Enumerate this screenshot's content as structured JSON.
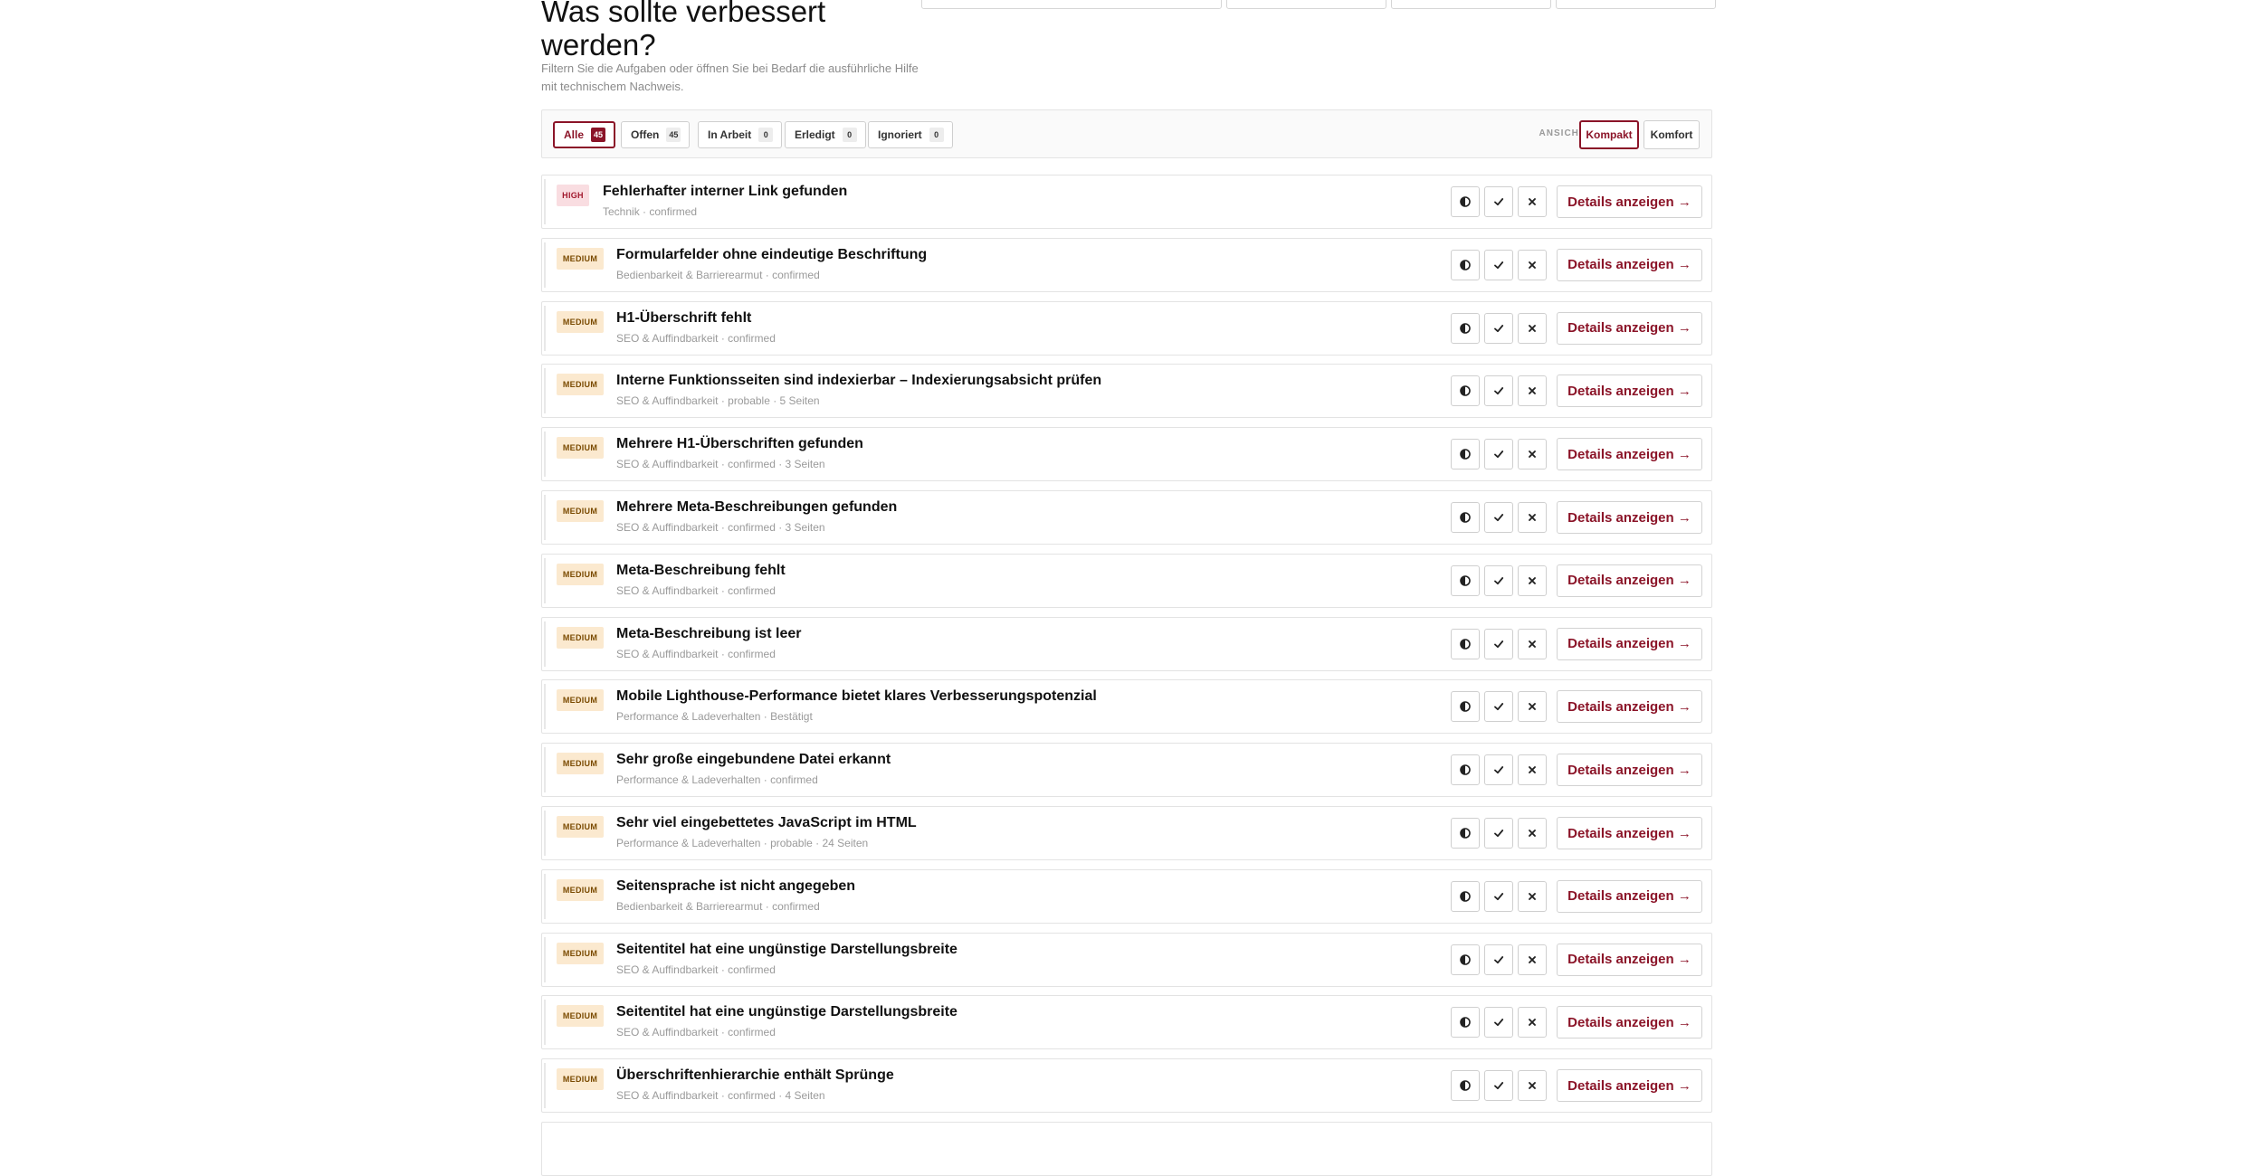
{
  "header": {
    "title": "Was sollte verbessert werden?",
    "subtitle": "Filtern Sie die Aufgaben oder öffnen Sie bei Bedarf die ausführliche Hilfe mit technischem Nachweis."
  },
  "filters": {
    "chips": [
      {
        "label": "Alle",
        "count": "45",
        "active": true
      },
      {
        "label": "Offen",
        "count": "45",
        "active": false
      },
      {
        "label": "In Arbeit",
        "count": "0",
        "active": false
      },
      {
        "label": "Erledigt",
        "count": "0",
        "active": false
      },
      {
        "label": "Ignoriert",
        "count": "0",
        "active": false
      }
    ],
    "view_label": "ANSICHT",
    "views": [
      {
        "label": "Kompakt",
        "active": true
      },
      {
        "label": "Komfort",
        "active": false
      }
    ]
  },
  "issue_actions": {
    "details_label": "Details anzeigen →",
    "icons": [
      "half-circle-icon",
      "check-icon",
      "close-icon"
    ]
  },
  "colors": {
    "accent": "#8b1428",
    "high_badge_bg": "#f9dde1",
    "medium_badge_bg": "#fbe9cf"
  },
  "issues": [
    {
      "severity": "HIGH",
      "title": "Fehlerhafter interner Link gefunden",
      "meta": "Technik · confirmed"
    },
    {
      "severity": "MEDIUM",
      "title": "Formularfelder ohne eindeutige Beschriftung",
      "meta": "Bedienbarkeit & Barrierearmut · confirmed"
    },
    {
      "severity": "MEDIUM",
      "title": "H1-Überschrift fehlt",
      "meta": "SEO & Auffindbarkeit · confirmed"
    },
    {
      "severity": "MEDIUM",
      "title": "Interne Funktionsseiten sind indexierbar – Indexierungsabsicht prüfen",
      "meta": "SEO & Auffindbarkeit · probable · 5 Seiten"
    },
    {
      "severity": "MEDIUM",
      "title": "Mehrere H1-Überschriften gefunden",
      "meta": "SEO & Auffindbarkeit · confirmed · 3 Seiten"
    },
    {
      "severity": "MEDIUM",
      "title": "Mehrere Meta-Beschreibungen gefunden",
      "meta": "SEO & Auffindbarkeit · confirmed · 3 Seiten"
    },
    {
      "severity": "MEDIUM",
      "title": "Meta-Beschreibung fehlt",
      "meta": "SEO & Auffindbarkeit · confirmed"
    },
    {
      "severity": "MEDIUM",
      "title": "Meta-Beschreibung ist leer",
      "meta": "SEO & Auffindbarkeit · confirmed"
    },
    {
      "severity": "MEDIUM",
      "title": "Mobile Lighthouse-Performance bietet klares Verbesserungspotenzial",
      "meta": "Performance & Ladeverhalten · Bestätigt"
    },
    {
      "severity": "MEDIUM",
      "title": "Sehr große eingebundene Datei erkannt",
      "meta": "Performance & Ladeverhalten · confirmed"
    },
    {
      "severity": "MEDIUM",
      "title": "Sehr viel eingebettetes JavaScript im HTML",
      "meta": "Performance & Ladeverhalten · probable · 24 Seiten"
    },
    {
      "severity": "MEDIUM",
      "title": "Seitensprache ist nicht angegeben",
      "meta": "Bedienbarkeit & Barrierearmut · confirmed"
    },
    {
      "severity": "MEDIUM",
      "title": "Seitentitel hat eine ungünstige Darstellungsbreite",
      "meta": "SEO & Auffindbarkeit · confirmed"
    },
    {
      "severity": "MEDIUM",
      "title": "Seitentitel hat eine ungünstige Darstellungsbreite",
      "meta": "SEO & Auffindbarkeit · confirmed"
    },
    {
      "severity": "MEDIUM",
      "title": "Überschriftenhierarchie enthält Sprünge",
      "meta": "SEO & Auffindbarkeit · confirmed · 4 Seiten"
    }
  ]
}
